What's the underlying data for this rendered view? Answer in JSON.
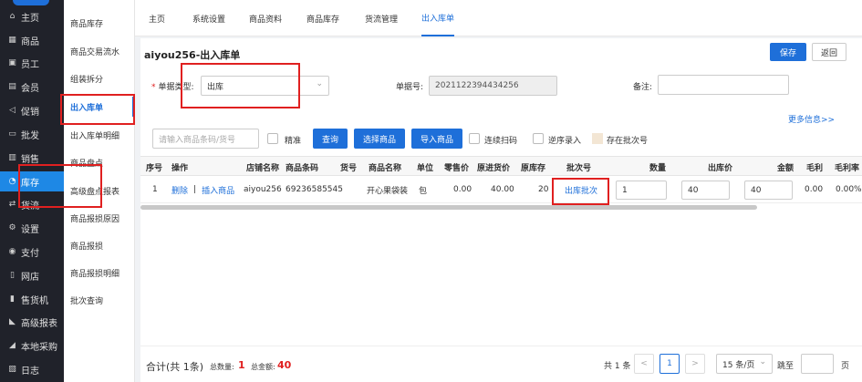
{
  "sidebar": {
    "items": [
      {
        "icon": "⌂",
        "label": "主页"
      },
      {
        "icon": "▦",
        "label": "商品"
      },
      {
        "icon": "▣",
        "label": "员工"
      },
      {
        "icon": "▤",
        "label": "会员"
      },
      {
        "icon": "◁",
        "label": "促销"
      },
      {
        "icon": "▭",
        "label": "批发"
      },
      {
        "icon": "▥",
        "label": "销售"
      },
      {
        "icon": "◔",
        "label": "库存"
      },
      {
        "icon": "⇄",
        "label": "货流"
      },
      {
        "icon": "⚙",
        "label": "设置"
      },
      {
        "icon": "◉",
        "label": "支付"
      },
      {
        "icon": "▯",
        "label": "网店"
      },
      {
        "icon": "▮",
        "label": "售货机"
      },
      {
        "icon": "◣",
        "label": "高级报表"
      },
      {
        "icon": "◢",
        "label": "本地采购"
      },
      {
        "icon": "▧",
        "label": "日志"
      }
    ]
  },
  "submenu": {
    "items": [
      "商品库存",
      "商品交易流水",
      "组装拆分",
      "出入库单",
      "出入库单明细",
      "商品盘点",
      "高级盘点报表",
      "商品报损原因",
      "商品报损",
      "商品报损明细",
      "批次查询"
    ]
  },
  "tabs": [
    "主页",
    "系统设置",
    "商品资料",
    "商品库存",
    "货流管理",
    "出入库单"
  ],
  "form": {
    "title": "aiyou256-出入库单",
    "save": "保存",
    "back": "返回",
    "type_label": "单据类型:",
    "type_value": "出库",
    "doc_no_label": "单据号:",
    "doc_no_value": "2021122394434256",
    "remark_label": "备注:",
    "more_info": "更多信息>>"
  },
  "toolbar": {
    "barcode_placeholder": "请输入商品条码/货号",
    "exact": "精准",
    "query": "查询",
    "select_goods": "选择商品",
    "import_goods": "导入商品",
    "continuous_scan": "连续扫码",
    "reverse_entry": "逆序录入",
    "batch_legend": "存在批次号"
  },
  "table": {
    "headers": [
      "序号",
      "操作",
      "店铺名称",
      "商品条码",
      "货号",
      "商品名称",
      "单位",
      "零售价",
      "原进货价",
      "原库存",
      "批次号",
      "数量",
      "出库价",
      "金额",
      "毛利",
      "毛利率"
    ],
    "row": {
      "index": "1",
      "op_delete": "删除",
      "op_sep": "|",
      "op_insert": "插入商品",
      "store": "aiyou256",
      "barcode": "69236585545",
      "item_no": "",
      "name": "开心果袋装",
      "unit": "包",
      "retail": "0.00",
      "cost": "40.00",
      "stock": "20",
      "batch": "出库批次",
      "qty": "1",
      "out_price": "40",
      "amount": "40",
      "profit": "0.00",
      "profit_rate": "0.00%"
    }
  },
  "footer": {
    "total": "合计(共 1条)",
    "qty_label": "总数量:",
    "qty_value": "1",
    "amount_label": "总金额:",
    "amount_value": "40",
    "pages": "共 1 条",
    "prev": "<",
    "page": "1",
    "next": ">",
    "per_page": "15 条/页",
    "goto": "跳至",
    "page_unit": "页"
  }
}
